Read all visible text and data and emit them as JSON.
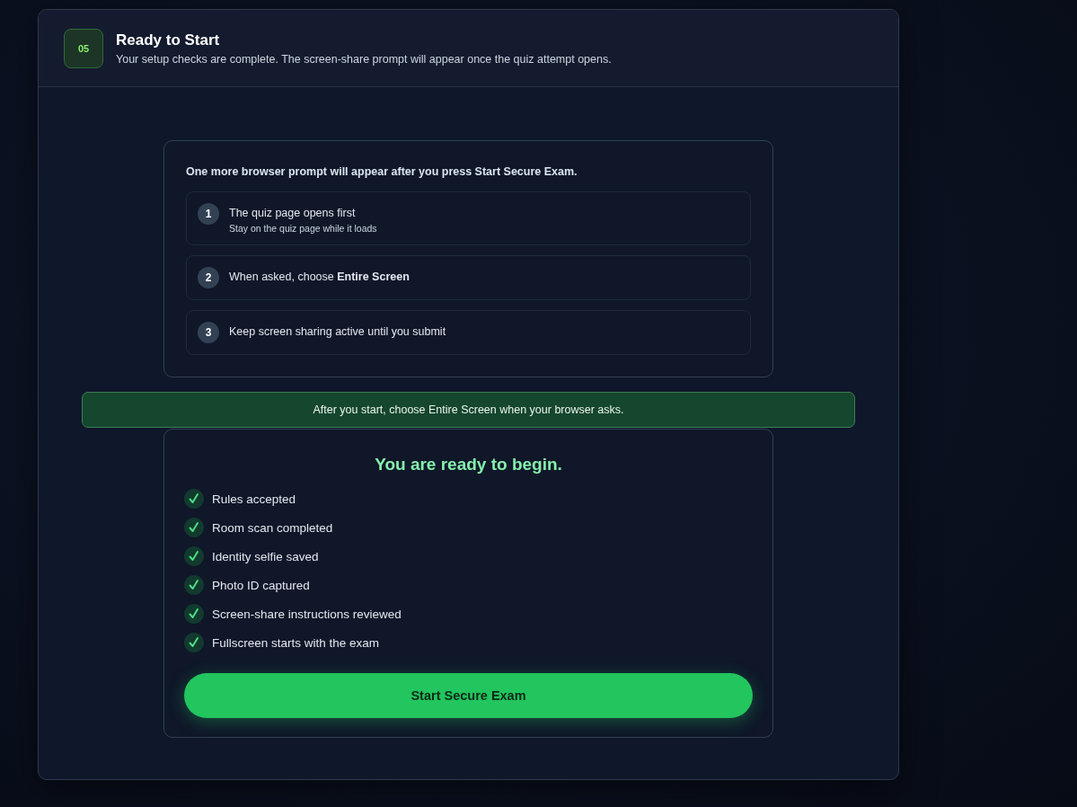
{
  "step": {
    "number": "05",
    "title": "Ready to Start",
    "subtitle": "Your setup checks are complete. The screen-share prompt will appear once the quiz attempt opens."
  },
  "prompt_info": {
    "intro": "One more browser prompt will appear after you press Start Secure Exam.",
    "steps": [
      {
        "number": "1",
        "title": "The quiz page opens first",
        "note": "Stay on the quiz page while it loads"
      },
      {
        "number": "2",
        "title": "When asked, choose **Entire Screen**"
      },
      {
        "number": "3",
        "title": "Keep screen sharing active until you submit"
      }
    ]
  },
  "banner": "After you start, choose Entire Screen when your browser asks.",
  "ready": {
    "heading": "You are ready to begin.",
    "checklist": [
      {
        "label": "Rules accepted",
        "checked": true
      },
      {
        "label": "Room scan completed",
        "checked": true
      },
      {
        "label": "Identity selfie saved",
        "checked": true
      },
      {
        "label": "Photo ID captured",
        "checked": true
      },
      {
        "label": "Screen-share instructions reviewed",
        "checked": true
      },
      {
        "label": "Fullscreen starts with the exam",
        "checked": true
      }
    ],
    "button": "Start Secure Exam"
  }
}
